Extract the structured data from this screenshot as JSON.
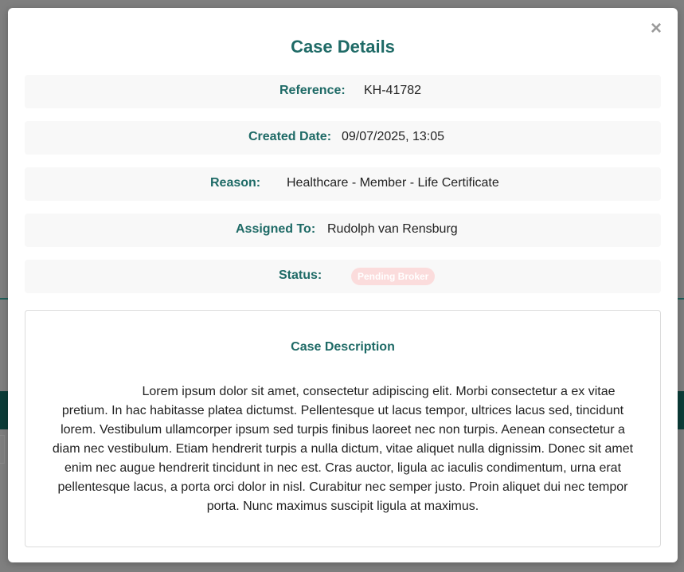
{
  "modal": {
    "title": "Case Details",
    "close_symbol": "×",
    "close_icon": "close-icon"
  },
  "details": {
    "reference": {
      "label": "Reference:",
      "value": "KH-41782"
    },
    "created_date": {
      "label": "Created Date:",
      "value": "09/07/2025, 13:05"
    },
    "reason": {
      "label": "Reason:",
      "value": "Healthcare - Member - Life Certificate"
    },
    "assigned_to": {
      "label": "Assigned To:",
      "value": "Rudolph van Rensburg"
    },
    "status": {
      "label": "Status:",
      "value": "Pending Broker"
    }
  },
  "description": {
    "title": "Case Description",
    "text": "Lorem ipsum dolor sit amet, consectetur adipiscing elit. Morbi consectetur a ex vitae pretium. In hac habitasse platea dictumst. Pellentesque ut lacus tempor, ultrices lacus sed, tincidunt lorem. Vestibulum ullamcorper ipsum sed turpis finibus laoreet nec non turpis. Aenean consectetur a diam nec vestibulum. Etiam hendrerit turpis a nulla dictum, vitae aliquet nulla dignissim. Donec sit amet enim nec augue hendrerit tincidunt in nec est. Cras auctor, ligula ac iaculis condimentum, urna erat pellentesque lacus, a porta orci dolor in nisl. Curabitur nec semper justo. Proin aliquet dui nec tempor porta. Nunc maximus suscipit ligula at maximus."
  },
  "colors": {
    "accent": "#1e6a66",
    "overlay": "#7f7f7f",
    "row_background": "#f8f8f8",
    "status_badge": "#fbdcdc"
  }
}
